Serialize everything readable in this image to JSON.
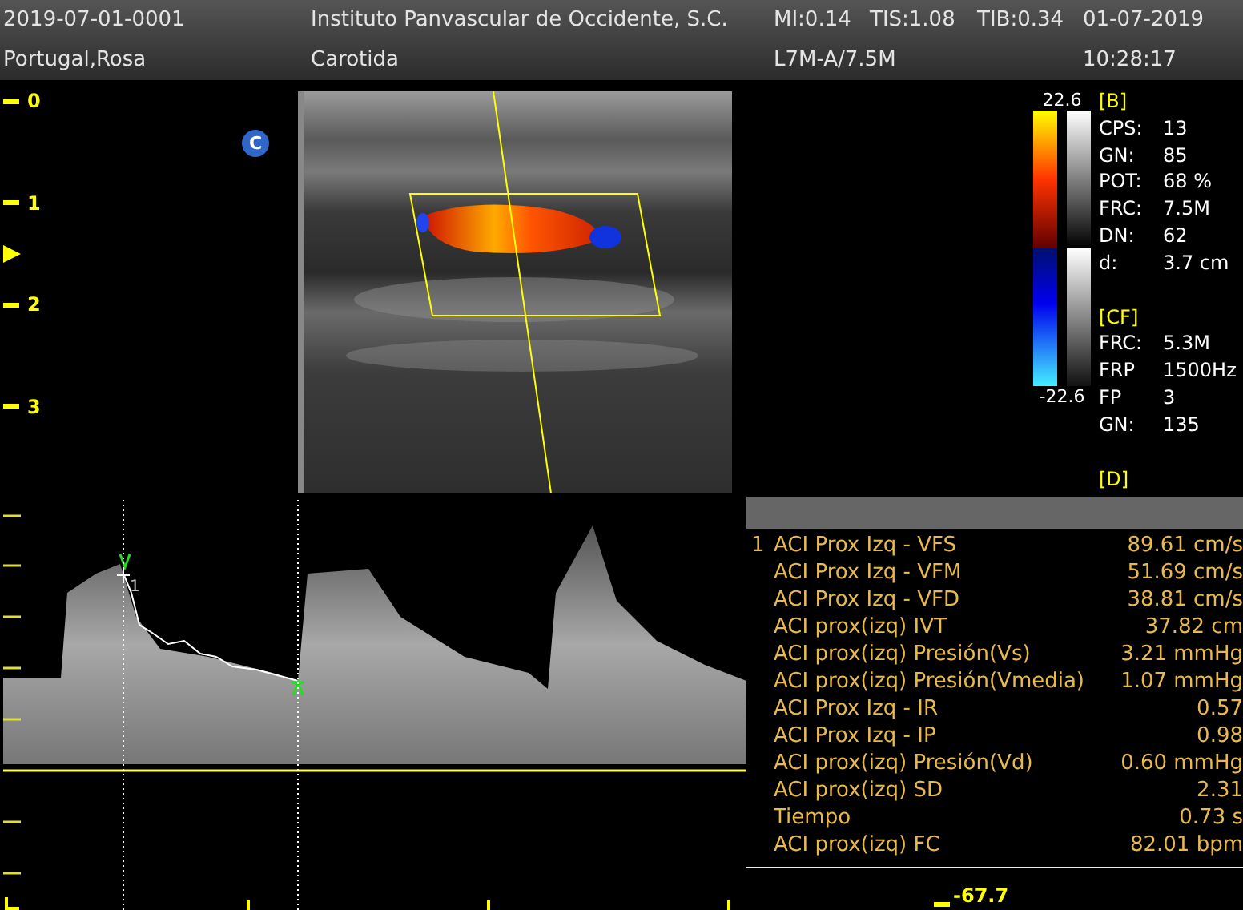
{
  "header": {
    "patient_id": "2019-07-01-0001",
    "institution": "Instituto Panvascular de Occidente, S.C.",
    "mi": "MI:0.14",
    "tis": "TIS:1.08",
    "tib": "TIB:0.34",
    "date": "01-07-2019",
    "patient_name": "Portugal,Rosa",
    "exam": "Carotida",
    "probe": "L7M-A/7.5M",
    "time": "10:28:17"
  },
  "depth_scale": {
    "labels": [
      "0",
      "1",
      "2",
      "3"
    ]
  },
  "image": {
    "badge": "C"
  },
  "color_scale": {
    "max": "22.6",
    "min": "-22.6"
  },
  "parameters": [
    {
      "title": "[B]",
      "items": [
        {
          "label": "CPS:",
          "value": "13"
        },
        {
          "label": "GN:",
          "value": "85"
        },
        {
          "label": "POT:",
          "value": "68 %"
        },
        {
          "label": "FRC:",
          "value": "7.5M"
        },
        {
          "label": "DN:",
          "value": "62"
        },
        {
          "label": "d:",
          "value": "3.7 cm"
        }
      ]
    },
    {
      "title": "[CF]",
      "items": [
        {
          "label": "FRC:",
          "value": "5.3M"
        },
        {
          "label": "FRP",
          "value": "1500Hz"
        },
        {
          "label": "FP",
          "value": "3"
        },
        {
          "label": "GN:",
          "value": "135"
        }
      ]
    },
    {
      "title": "[D]"
    }
  ],
  "doppler": {
    "cursor_label": "1"
  },
  "measurements": {
    "index": "1",
    "rows": [
      {
        "label": "ACI Prox Izq - VFS",
        "value": "89.61 cm/s"
      },
      {
        "label": "ACI Prox Izq - VFM",
        "value": "51.69 cm/s"
      },
      {
        "label": "ACI Prox Izq - VFD",
        "value": "38.81 cm/s"
      },
      {
        "label": "ACI prox(izq) IVT",
        "value": "37.82 cm"
      },
      {
        "label": "ACI prox(izq) Presión(Vs)",
        "value": "3.21 mmHg"
      },
      {
        "label": "ACI prox(izq) Presión(Vmedia)",
        "value": "1.07 mmHg"
      },
      {
        "label": "ACI Prox Izq - IR",
        "value": "0.57"
      },
      {
        "label": "ACI Prox Izq - IP",
        "value": "0.98"
      },
      {
        "label": "ACI prox(izq) Presión(Vd)",
        "value": "0.60 mmHg"
      },
      {
        "label": "ACI prox(izq) SD",
        "value": "2.31"
      },
      {
        "label": "Tiempo",
        "value": "0.73 s"
      },
      {
        "label": "ACI prox(izq) FC",
        "value": "82.01 bpm"
      }
    ],
    "scale_value": "-67.7"
  }
}
